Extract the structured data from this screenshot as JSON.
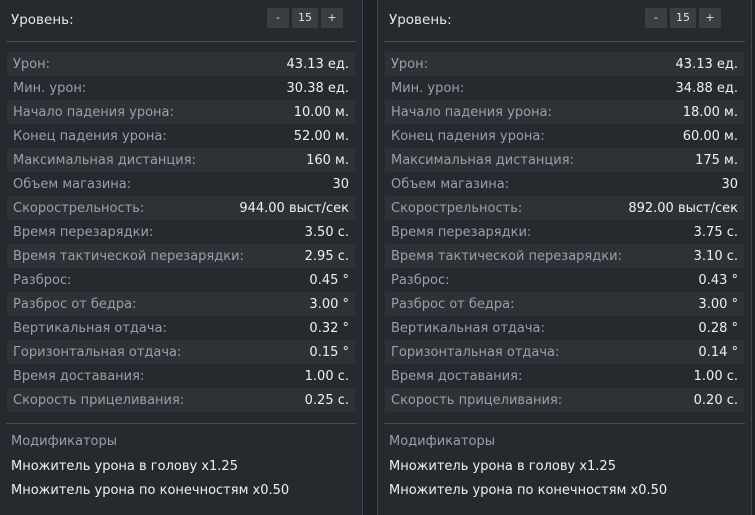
{
  "left": {
    "level_label": "Уровень:",
    "level_minus": "-",
    "level_value": "15",
    "level_plus": "+",
    "stats": [
      {
        "label": "Урон:",
        "value": "43.13 ед."
      },
      {
        "label": "Мин. урон:",
        "value": "30.38 ед."
      },
      {
        "label": "Начало падения урона:",
        "value": "10.00 м."
      },
      {
        "label": "Конец падения урона:",
        "value": "52.00 м."
      },
      {
        "label": "Максимальная дистанция:",
        "value": "160 м."
      },
      {
        "label": "Объем магазина:",
        "value": "30"
      },
      {
        "label": "Скорострельность:",
        "value": "944.00 выст/сек"
      },
      {
        "label": "Время перезарядки:",
        "value": "3.50 с."
      },
      {
        "label": "Время тактической перезарядки:",
        "value": "2.95 с."
      },
      {
        "label": "Разброс:",
        "value": "0.45 °"
      },
      {
        "label": "Разброс от бедра:",
        "value": "3.00 °"
      },
      {
        "label": "Вертикальная отдача:",
        "value": "0.32 °"
      },
      {
        "label": "Горизонтальная отдача:",
        "value": "0.15 °"
      },
      {
        "label": "Время доставания:",
        "value": "1.00 с."
      },
      {
        "label": "Скорость прицеливания:",
        "value": "0.25 с."
      }
    ],
    "modifiers_title": "Модификаторы",
    "modifiers": [
      "Множитель урона в голову x1.25",
      "Множитель урона по конечностям x0.50"
    ]
  },
  "right": {
    "level_label": "Уровень:",
    "level_minus": "-",
    "level_value": "15",
    "level_plus": "+",
    "stats": [
      {
        "label": "Урон:",
        "value": "43.13 ед."
      },
      {
        "label": "Мин. урон:",
        "value": "34.88 ед."
      },
      {
        "label": "Начало падения урона:",
        "value": "18.00 м."
      },
      {
        "label": "Конец падения урона:",
        "value": "60.00 м."
      },
      {
        "label": "Максимальная дистанция:",
        "value": "175 м."
      },
      {
        "label": "Объем магазина:",
        "value": "30"
      },
      {
        "label": "Скорострельность:",
        "value": "892.00 выст/сек"
      },
      {
        "label": "Время перезарядки:",
        "value": "3.75 с."
      },
      {
        "label": "Время тактической перезарядки:",
        "value": "3.10 с."
      },
      {
        "label": "Разброс:",
        "value": "0.43 °"
      },
      {
        "label": "Разброс от бедра:",
        "value": "3.00 °"
      },
      {
        "label": "Вертикальная отдача:",
        "value": "0.28 °"
      },
      {
        "label": "Горизонтальная отдача:",
        "value": "0.14 °"
      },
      {
        "label": "Время доставания:",
        "value": "1.00 с."
      },
      {
        "label": "Скорость прицеливания:",
        "value": "0.20 с."
      }
    ],
    "modifiers_title": "Модификаторы",
    "modifiers": [
      "Множитель урона в голову x1.25",
      "Множитель урона по конечностям x0.50"
    ]
  }
}
